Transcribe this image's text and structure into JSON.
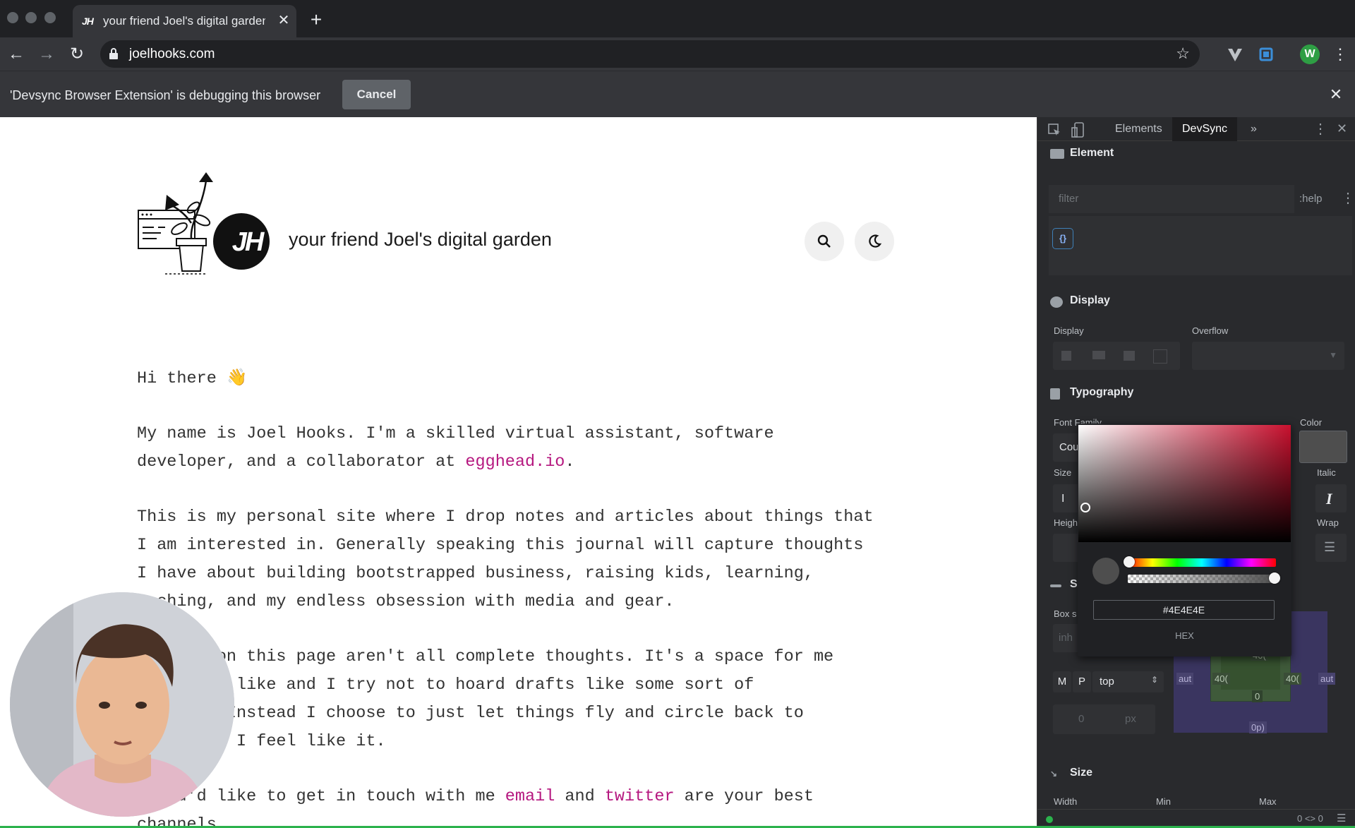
{
  "browser": {
    "tab_title": "your friend Joel's digital garden",
    "tab_favicon": "JH",
    "new_tab": "+",
    "url": "joelhooks.com",
    "profile_initial": "W"
  },
  "infobar": {
    "message": "'Devsync Browser Extension' is debugging this browser",
    "cancel_label": "Cancel"
  },
  "site": {
    "title": "your friend Joel's digital garden",
    "logo_text": "JH",
    "paragraphs": {
      "p1": "Hi there",
      "p1_emoji": "👋",
      "p2_l1": "My name is Joel Hooks. I'm a skilled virtual assistant, software",
      "p2_l2_pre": "developer, and a collaborator at ",
      "p2_link": "egghead.io",
      "p2_l2_post": ".",
      "p3_l1": "This is my personal site where I drop notes and articles about things that",
      "p3_l2": "I am interested in. Generally speaking this journal will capture thoughts",
      "p3_l3": "I have about building bootstrapped business, raising kids, learning,",
      "p3_l4": "  ching, and my endless obsession with media and gear.",
      "p4_l1": "    ies on this page aren't all complete thoughts. It's a space for me",
      "p4_l2": "    hat I like and I try not to hoard drafts like some sort of",
      "p4_l3": "    mog. Instead I choose to just let things fly and circle back to",
      "p4_l4": "    er if I feel like it.",
      "p5_pre": "  you'd like to get in touch with me ",
      "p5_link1": "email",
      "p5_mid": " and ",
      "p5_link2": "twitter",
      "p5_post": " are your best",
      "p5_l2": "channels"
    }
  },
  "devtools": {
    "tabs": [
      "Elements",
      "DevSync",
      "»"
    ],
    "sections": {
      "element": "Element",
      "display": "Display",
      "typography": "Typography",
      "spacing": "Sp",
      "size": "Size"
    },
    "filter_placeholder": "filter",
    "help": ":help",
    "brace": "{}",
    "labels": {
      "display": "Display",
      "overflow": "Overflow",
      "font_family": "Font Family",
      "color": "Color",
      "size": "Size",
      "italic": "Italic",
      "height": "Heigh",
      "wrap": "Wrap",
      "box": "Box s",
      "width": "Width",
      "min": "Min",
      "max": "Max"
    },
    "font_value": "Cou",
    "box_value": "inh",
    "spacing": {
      "m": "M",
      "p": "P",
      "side": "top",
      "value": "0",
      "unit": "px",
      "box_left": "aut",
      "box_right": "aut",
      "box_40l": "40(",
      "box_40r": "40(",
      "box_top": "40(",
      "box_center": "0",
      "box_bottom": "0p)"
    },
    "color_picker": {
      "hex": "#4E4E4E",
      "format": "HEX",
      "swatch_color": "#4e4e4e"
    },
    "status": "0 <> 0"
  }
}
